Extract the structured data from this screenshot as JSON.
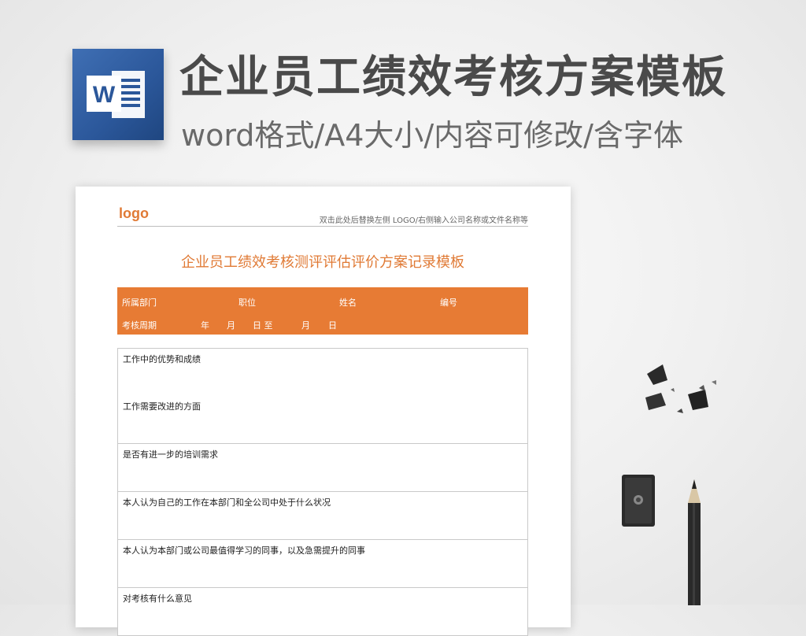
{
  "banner": {
    "title": "企业员工绩效考核方案模板",
    "subtitle": "word格式/A4大小/内容可修改/含字体",
    "icon": "word-app-icon",
    "icon_letter": "W"
  },
  "document": {
    "logo": "logo",
    "header_note": "双击此处后替换左侧 LOGO/右侧输入公司名称或文件名称等",
    "title": "企业员工绩效考核测评评估评价方案记录模板",
    "info": {
      "department": "所属部门",
      "position": "职位",
      "name": "姓名",
      "number": "编号",
      "period": "考核周期",
      "year": "年",
      "month1": "月",
      "day_to": "日 至",
      "month2": "月",
      "day2": "日"
    },
    "sections": [
      "工作中的优势和成绩",
      "工作需要改进的方面",
      "是否有进一步的培训需求",
      "本人认为自己的工作在本部门和全公司中处于什么状况",
      "本人认为本部门或公司最值得学习的同事，以及急需提升的同事",
      "对考核有什么意见"
    ],
    "accent_color": "#e77b34"
  }
}
